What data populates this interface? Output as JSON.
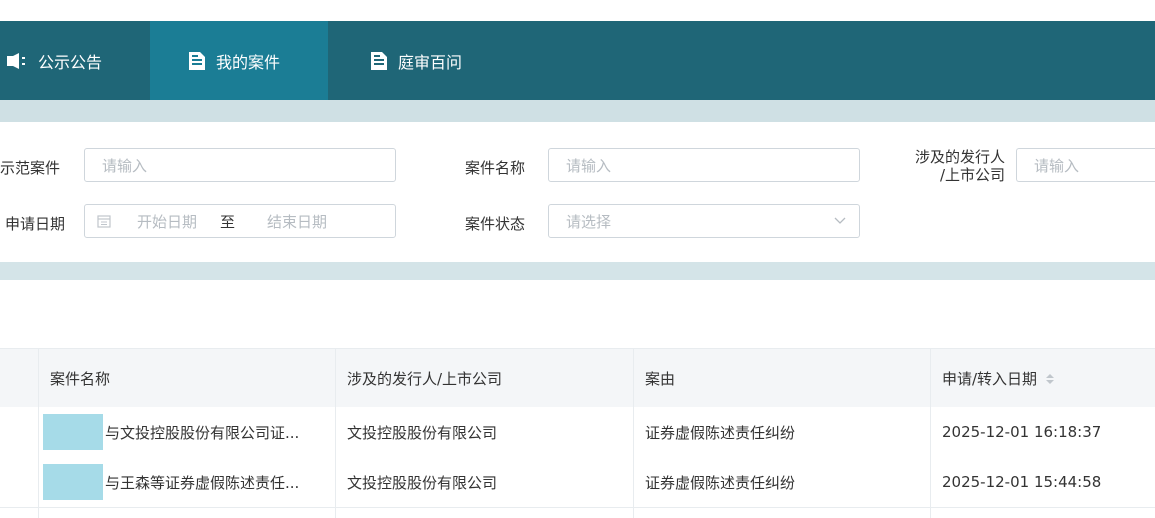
{
  "nav": {
    "tabs": [
      {
        "label": "公示公告",
        "icon": "speaker-icon"
      },
      {
        "label": "我的案件",
        "icon": "document-icon"
      },
      {
        "label": "庭审百问",
        "icon": "document-icon"
      }
    ],
    "active_tab": "我的案件"
  },
  "filters": {
    "demo_case_label": "示范案件",
    "demo_case_placeholder": "请输入",
    "case_name_label": "案件名称",
    "case_name_placeholder": "请输入",
    "issuer_label_line1": "涉及的发行人",
    "issuer_label_line2": "/上市公司",
    "issuer_placeholder": "请输入",
    "apply_date_label": "申请日期",
    "start_date_placeholder": "开始日期",
    "date_separator": "至",
    "end_date_placeholder": "结束日期",
    "case_status_label": "案件状态",
    "case_status_placeholder": "请选择"
  },
  "table": {
    "headers": {
      "case_name": "案件名称",
      "issuer": "涉及的发行人/上市公司",
      "cause": "案由",
      "date": "申请/转入日期"
    },
    "rows": [
      {
        "case_name": "与文投控股股份有限公司证...",
        "issuer": "文投控股股份有限公司",
        "cause": "证券虚假陈述责任纠纷",
        "date": "2025-12-01 16:18:37"
      },
      {
        "case_name": "与王森等证券虚假陈述责任...",
        "issuer": "文投控股股份有限公司",
        "cause": "证券虚假陈述责任纠纷",
        "date": "2025-12-01 15:44:58"
      }
    ]
  },
  "colors": {
    "nav_bg": "#1f6677",
    "nav_active": "#1b7d95",
    "mask": "#a6dbe8"
  }
}
